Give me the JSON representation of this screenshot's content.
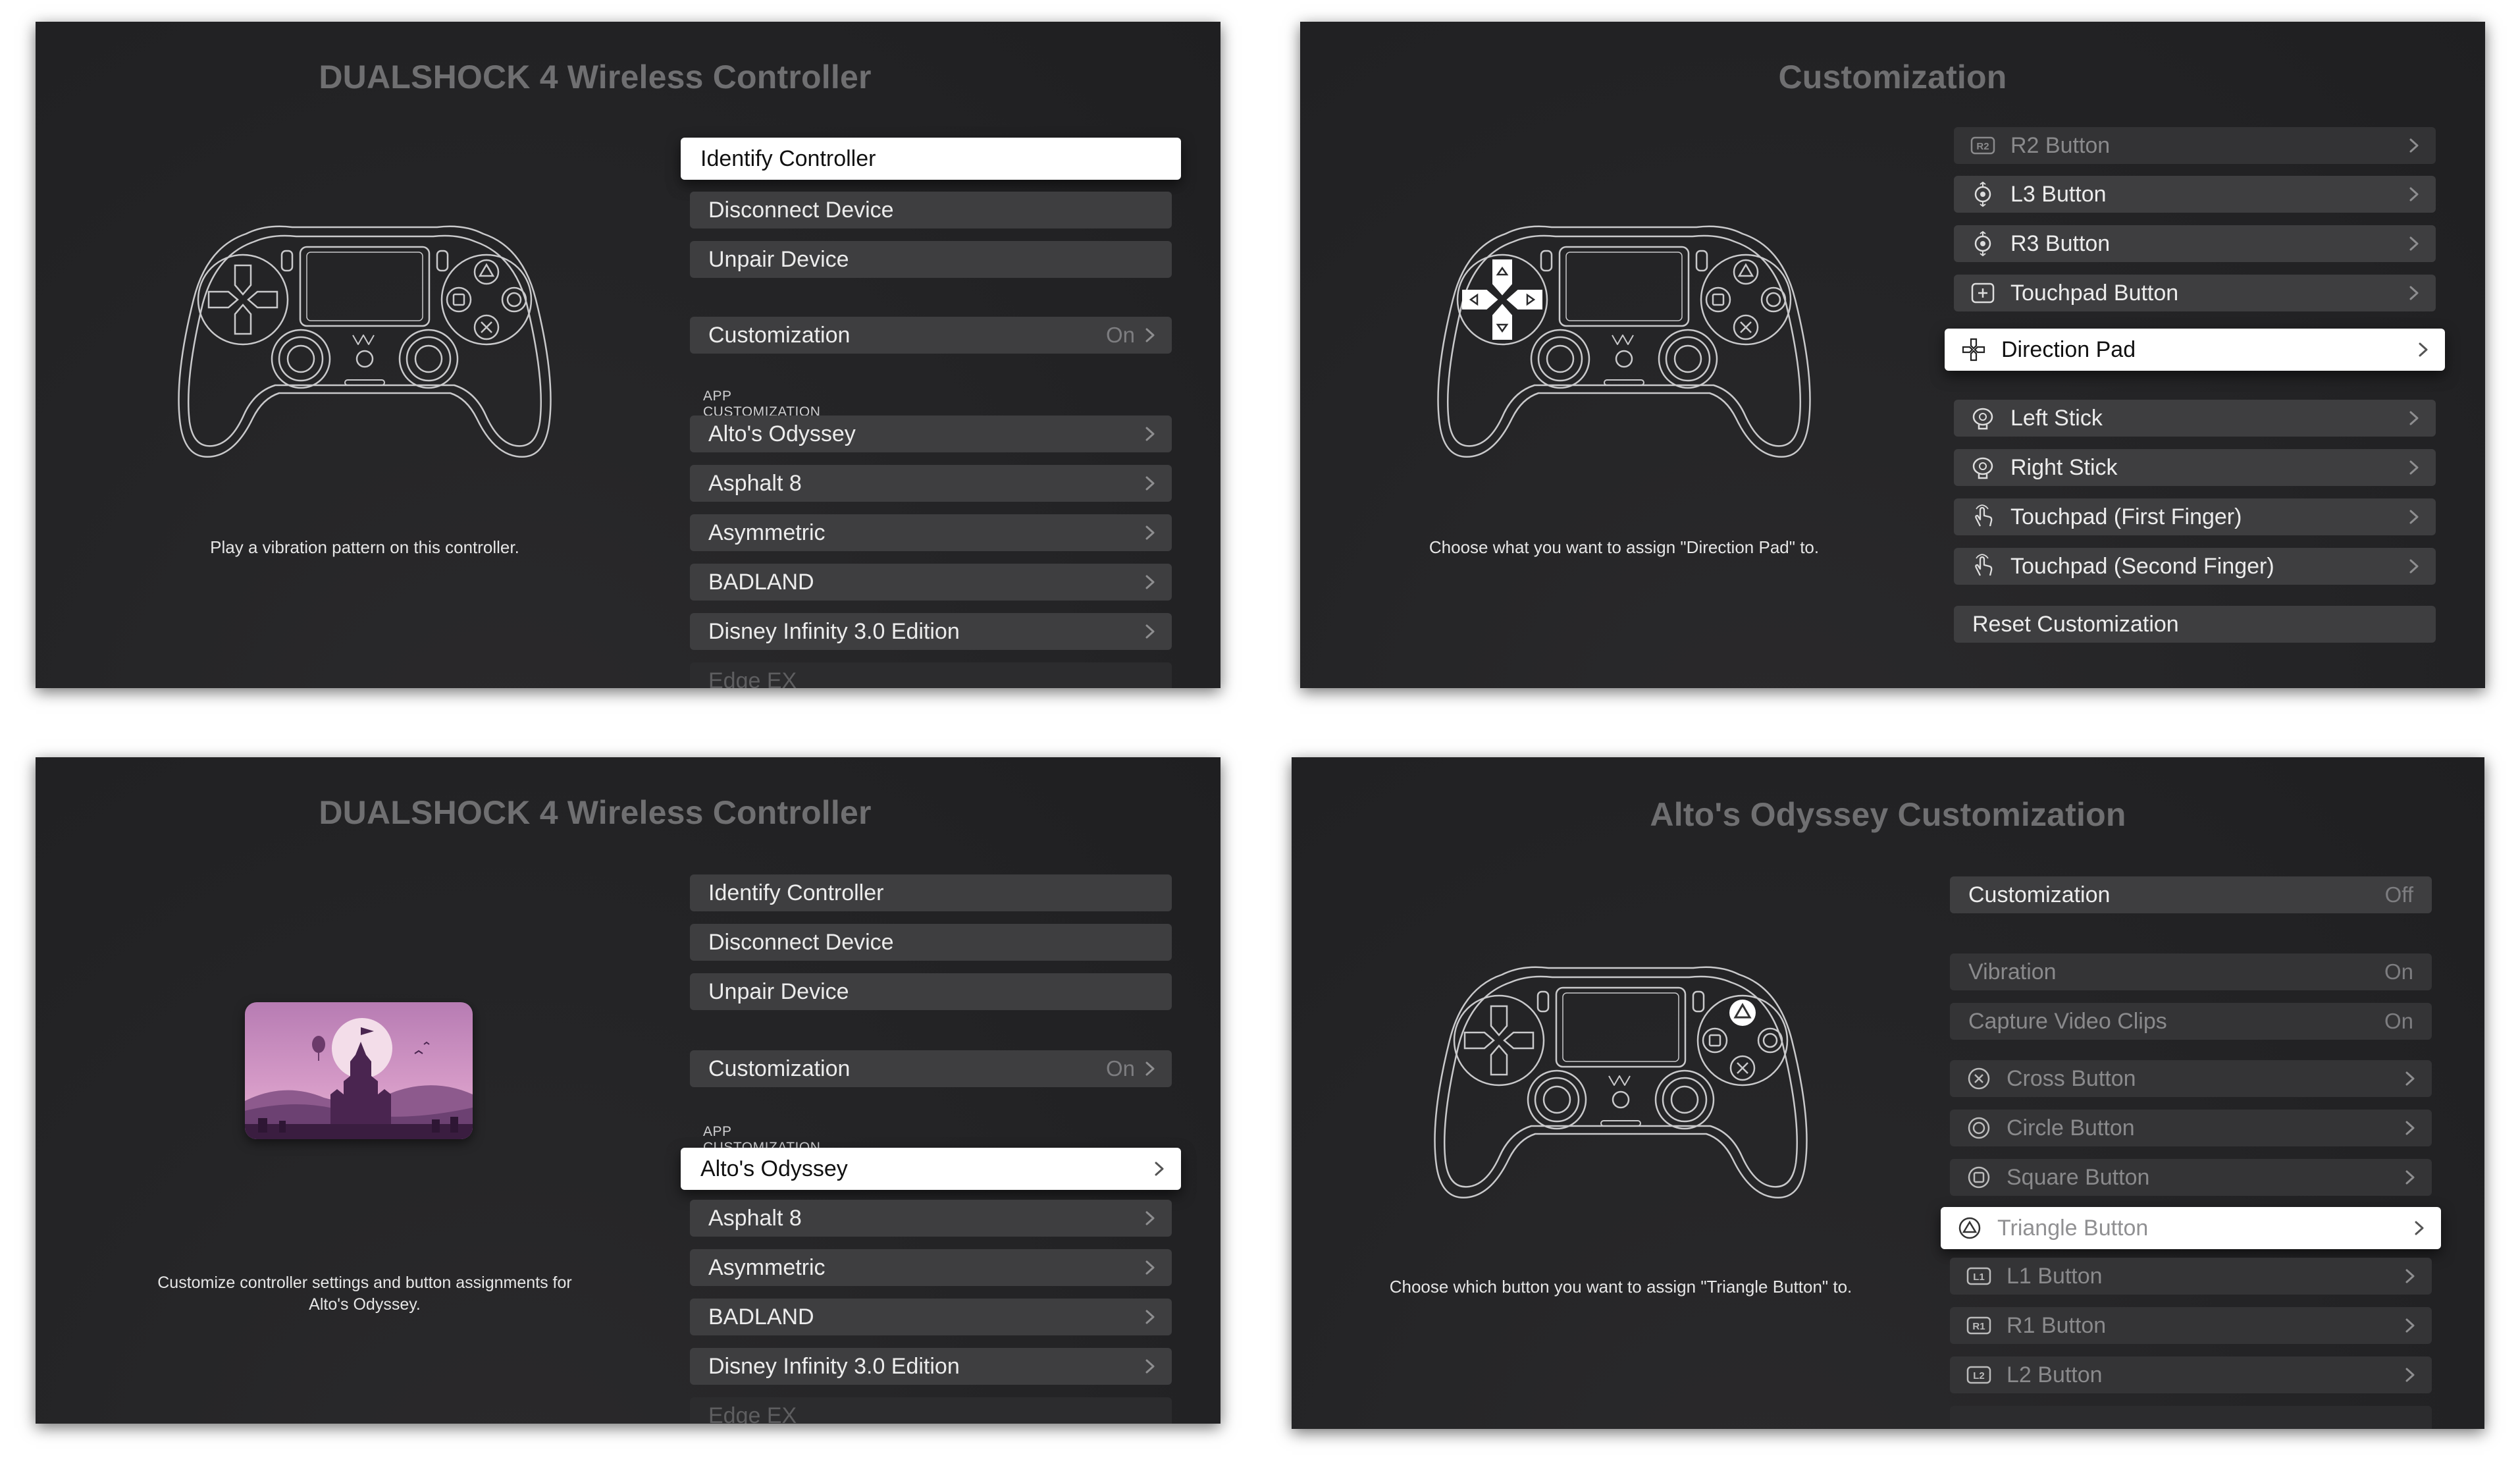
{
  "panel1": {
    "title": "DUALSHOCK 4 Wireless Controller",
    "caption": "Play a vibration pattern on this controller.",
    "items": [
      {
        "label": "Identify Controller"
      },
      {
        "label": "Disconnect Device"
      },
      {
        "label": "Unpair Device"
      }
    ],
    "customization": {
      "label": "Customization",
      "value": "On"
    },
    "section_label": "APP CUSTOMIZATION",
    "apps": [
      "Alto's Odyssey",
      "Asphalt 8",
      "Asymmetric",
      "BADLAND",
      "Disney Infinity 3.0 Edition",
      "Edge EX"
    ],
    "selected": "Identify Controller"
  },
  "panel2": {
    "title": "Customization",
    "caption": "Choose what you want to assign \"Direction Pad\" to.",
    "items": [
      {
        "label": "R2 Button",
        "icon": "r2-badge-icon"
      },
      {
        "label": "L3 Button",
        "icon": "stick-press-icon"
      },
      {
        "label": "R3 Button",
        "icon": "stick-press-icon"
      },
      {
        "label": "Touchpad Button",
        "icon": "touchpad-button-icon"
      },
      {
        "label": "Direction Pad",
        "icon": "dpad-icon"
      },
      {
        "label": "Left Stick",
        "icon": "stick-icon"
      },
      {
        "label": "Right Stick",
        "icon": "stick-icon"
      },
      {
        "label": "Touchpad (First Finger)",
        "icon": "finger-touch-icon"
      },
      {
        "label": "Touchpad (Second Finger)",
        "icon": "finger-touch-icon"
      }
    ],
    "reset_label": "Reset Customization",
    "selected": "Direction Pad"
  },
  "panel3": {
    "title": "DUALSHOCK 4 Wireless Controller",
    "caption_line1": "Customize controller settings and button assignments for",
    "caption_line2": "Alto's Odyssey.",
    "items": [
      {
        "label": "Identify Controller"
      },
      {
        "label": "Disconnect Device"
      },
      {
        "label": "Unpair Device"
      }
    ],
    "customization": {
      "label": "Customization",
      "value": "On"
    },
    "section_label": "APP CUSTOMIZATION",
    "apps": [
      "Alto's Odyssey",
      "Asphalt 8",
      "Asymmetric",
      "BADLAND",
      "Disney Infinity 3.0 Edition",
      "Edge EX"
    ],
    "selected": "Alto's Odyssey"
  },
  "panel4": {
    "title": "Alto's Odyssey Customization",
    "caption": "Choose which button you want to assign \"Triangle Button\" to.",
    "customization": {
      "label": "Customization",
      "value": "Off"
    },
    "vibration": {
      "label": "Vibration",
      "value": "On"
    },
    "capture": {
      "label": "Capture Video Clips",
      "value": "On"
    },
    "buttons": [
      {
        "label": "Cross Button",
        "icon": "cross-button-icon"
      },
      {
        "label": "Circle Button",
        "icon": "circle-button-icon"
      },
      {
        "label": "Square Button",
        "icon": "square-button-icon"
      },
      {
        "label": "Triangle Button",
        "icon": "triangle-button-icon"
      },
      {
        "label": "L1 Button",
        "icon": "l1-badge-icon"
      },
      {
        "label": "R1 Button",
        "icon": "r1-badge-icon"
      },
      {
        "label": "L2 Button",
        "icon": "l2-badge-icon"
      }
    ],
    "selected": "Triangle Button"
  },
  "badges": {
    "r2": "R2",
    "l1": "L1",
    "r1": "R1",
    "l2": "L2"
  },
  "colors": {
    "panel_bg": "#252527",
    "row_bg": "#3e3e40",
    "selected_bg": "#ffffff",
    "title": "#6f6f71"
  }
}
